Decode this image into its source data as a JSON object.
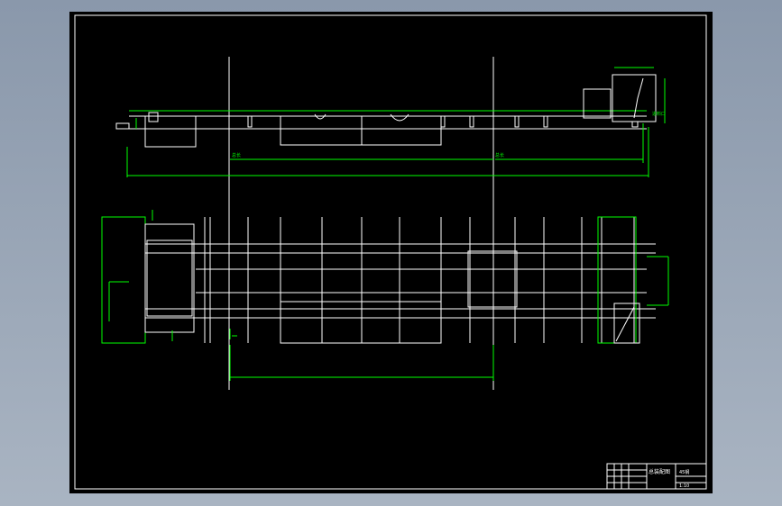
{
  "drawing": {
    "background": "#000000",
    "line_color": "#ffffff",
    "dimension_color": "#00ff00",
    "title_block": {
      "title": "总装配图",
      "material_cell": "45钢",
      "scale_cell": "1:10"
    }
  },
  "labels": {
    "front_left_note": "总长",
    "front_right_note": "总长",
    "front_right_tag": "进料口"
  }
}
